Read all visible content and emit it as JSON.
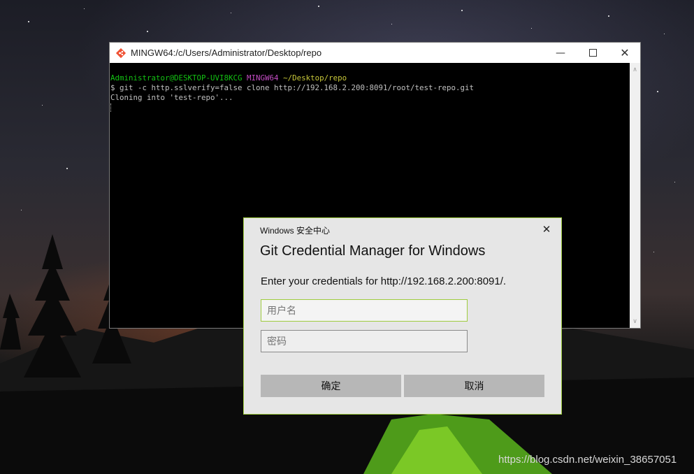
{
  "terminal": {
    "title": "MINGW64:/c/Users/Administrator/Desktop/repo",
    "prompt_user_host": "Administrator@DESKTOP-UVI8KCG",
    "prompt_env": "MINGW64",
    "prompt_path": "~/Desktop/repo",
    "command_line": "$ git -c http.sslverify=false clone http://192.168.2.200:8091/root/test-repo.git",
    "output_line": "Cloning into 'test-repo'..."
  },
  "dialog": {
    "caption": "Windows 安全中心",
    "heading": "Git Credential Manager for Windows",
    "message": "Enter your credentials for http://192.168.2.200:8091/.",
    "username_placeholder": "用户名",
    "password_placeholder": "密码",
    "ok_label": "确定",
    "cancel_label": "取消"
  },
  "watermark": "https://blog.csdn.net/weixin_38657051",
  "colors": {
    "prompt_user": "#13c313",
    "prompt_env": "#c34cc3",
    "prompt_path": "#c9c93a",
    "dialog_accent": "#9fcc3f"
  },
  "icons": [
    "git-app-icon",
    "minimize-icon",
    "maximize-icon",
    "close-icon",
    "scroll-up-arrow-icon",
    "scroll-down-arrow-icon"
  ]
}
